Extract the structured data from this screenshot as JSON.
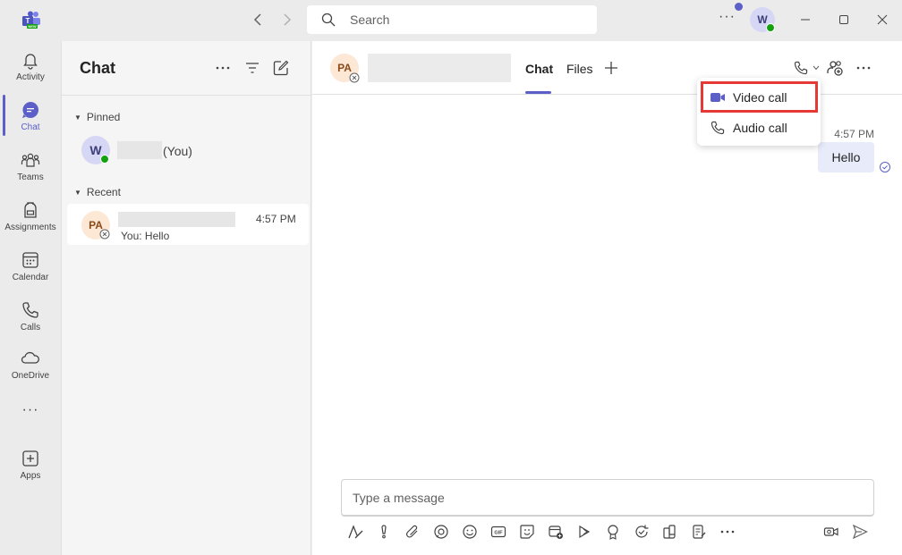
{
  "titlebar": {
    "search_placeholder": "Search",
    "more": "···",
    "user_initial": "W"
  },
  "rail": {
    "items": [
      {
        "label": "Activity",
        "icon": "bell-icon"
      },
      {
        "label": "Chat",
        "icon": "chat-icon"
      },
      {
        "label": "Teams",
        "icon": "teams-icon"
      },
      {
        "label": "Assignments",
        "icon": "backpack-icon"
      },
      {
        "label": "Calendar",
        "icon": "calendar-icon"
      },
      {
        "label": "Calls",
        "icon": "phone-icon"
      },
      {
        "label": "OneDrive",
        "icon": "cloud-icon"
      },
      {
        "label": "Apps",
        "icon": "add-app-icon"
      }
    ],
    "more": "···"
  },
  "chatlist": {
    "title": "Chat",
    "pinned_label": "Pinned",
    "recent_label": "Recent",
    "pinned_item": {
      "initial": "W",
      "suffix": "(You)"
    },
    "recent_item": {
      "initials": "PA",
      "time": "4:57 PM",
      "preview": "You: Hello"
    }
  },
  "main": {
    "contact_initials": "PA",
    "tabs": [
      "Chat",
      "Files"
    ],
    "message": {
      "time": "4:57 PM",
      "text": "Hello"
    },
    "dropdown": {
      "video_call": "Video call",
      "audio_call": "Audio call"
    },
    "compose_placeholder": "Type a message"
  },
  "colors": {
    "accent": "#5b5fc7",
    "highlight": "#e53935",
    "presence": "#13a10e"
  }
}
